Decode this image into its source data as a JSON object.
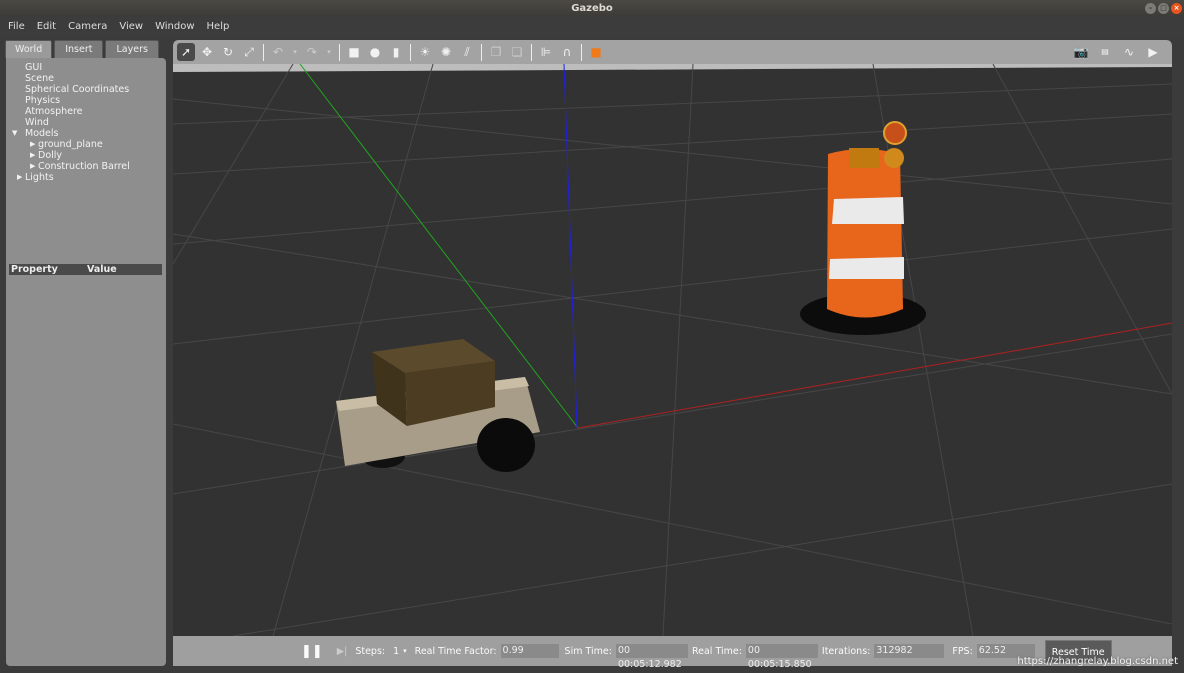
{
  "window": {
    "title": "Gazebo"
  },
  "menu": [
    "File",
    "Edit",
    "Camera",
    "View",
    "Window",
    "Help"
  ],
  "left_panel": {
    "tabs": [
      "World",
      "Insert",
      "Layers"
    ],
    "tree": {
      "gui": "GUI",
      "scene": "Scene",
      "spherical": "Spherical Coordinates",
      "physics": "Physics",
      "atmosphere": "Atmosphere",
      "wind": "Wind",
      "models": "Models",
      "model_items": [
        "ground_plane",
        "Dolly",
        "Construction Barrel"
      ],
      "lights": "Lights"
    },
    "property_header": {
      "property": "Property",
      "value": "Value"
    }
  },
  "toolbar": {
    "icons": [
      "select-mode",
      "translate-mode",
      "rotate-mode",
      "scale-mode",
      "undo",
      "undo-dropdown",
      "redo",
      "redo-dropdown",
      "box-shape",
      "sphere-shape",
      "cylinder-shape",
      "point-light",
      "spot-light",
      "directional-light",
      "copy",
      "paste",
      "align",
      "snap",
      "change-view"
    ],
    "right_icons": [
      "screenshot",
      "log",
      "plot",
      "record-video"
    ]
  },
  "bottom_bar": {
    "steps_label": "Steps:",
    "steps_value": "1",
    "rtf_label": "Real Time Factor:",
    "rtf_value": "0.99",
    "sim_time_label": "Sim Time:",
    "sim_time_value": "00 00:05:12.982",
    "real_time_label": "Real Time:",
    "real_time_value": "00 00:05:15.850",
    "iterations_label": "Iterations:",
    "iterations_value": "312982",
    "fps_label": "FPS:",
    "fps_value": "62.52",
    "reset_label": "Reset Time"
  },
  "watermark": "https://zhangrelay.blog.csdn.net",
  "colors": {
    "accent": "#e95420",
    "barrel_orange": "#e8651c",
    "scene_bg": "#333333"
  }
}
